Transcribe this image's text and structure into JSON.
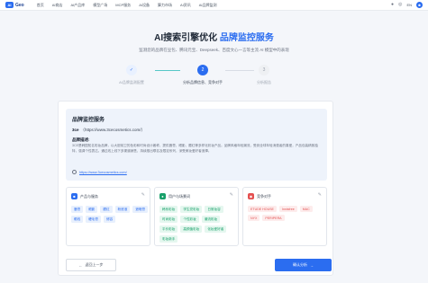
{
  "nav": {
    "logo_mark": "AI",
    "logo_text": "Geo",
    "items": [
      "首页",
      "AI商店",
      "AI产品库",
      "模型广场",
      "MCP服务",
      "AI设备",
      "算力市场",
      "AI资讯",
      "AI品牌监测"
    ],
    "lang": "EN"
  },
  "hero": {
    "title_main": "AI搜索引擎优化 ",
    "title_accent": "品牌监控服务",
    "subtitle": "监测您的品牌在豆包、腾讯元宝、Deepseek、百度文心一言等主流 AI 模型中的表现"
  },
  "steps": [
    {
      "num": "✓",
      "label": "AI品牌监测配置"
    },
    {
      "num": "2",
      "label": "分析品牌信息、竞争对手"
    },
    {
      "num": "3",
      "label": "分析报告"
    }
  ],
  "brand": {
    "section_title": "品牌监控服务",
    "name": "3ce",
    "url_paren": "（https://www.3cecosmetics.com/）",
    "desc_label": "品牌描述:",
    "description": "3CE是韩国知名彩妆品牌，以大胆前卫的色彩和时尚设计著称，提供唇膏、眼影、腮红等多样化彩妆产品。品牌风格年轻潮流，受到全球年轻消费者的喜爱，产品包装精致独特，强调个性表达。通过线上线下多渠道销售，持续推出联名及限定系列，深受美妆爱好者追捧。",
    "link": "https://www.3cecosmetics.com/"
  },
  "cards": [
    {
      "title": "产品与服务",
      "icon_color": "#2b6df0",
      "chip_style": "blue",
      "chips": [
        "唇膏",
        "眼影",
        "腮红",
        "粉底液",
        "遮瑕膏",
        "眼线",
        "睫毛膏",
        "修容"
      ]
    },
    {
      "title": "用户与场景词",
      "icon_color": "#18a06a",
      "chip_style": "green",
      "chips": [
        "韩系彩妆",
        "学生党彩妆",
        "日常妆容",
        "时尚彩妆",
        "个性彩妆",
        "潮流彩妆",
        "平价彩妆",
        "高颜值彩妆",
        "化妆爱好者",
        "彩妆新手"
      ]
    },
    {
      "title": "竞争对手",
      "icon_color": "#e45050",
      "chip_style": "red",
      "chips": [
        "ETUDE HOUSE",
        "Innisfree",
        "MAC",
        "NYX",
        "PERIPERA"
      ]
    }
  ],
  "buttons": {
    "back": "返回上一步",
    "next": "确认分析"
  }
}
